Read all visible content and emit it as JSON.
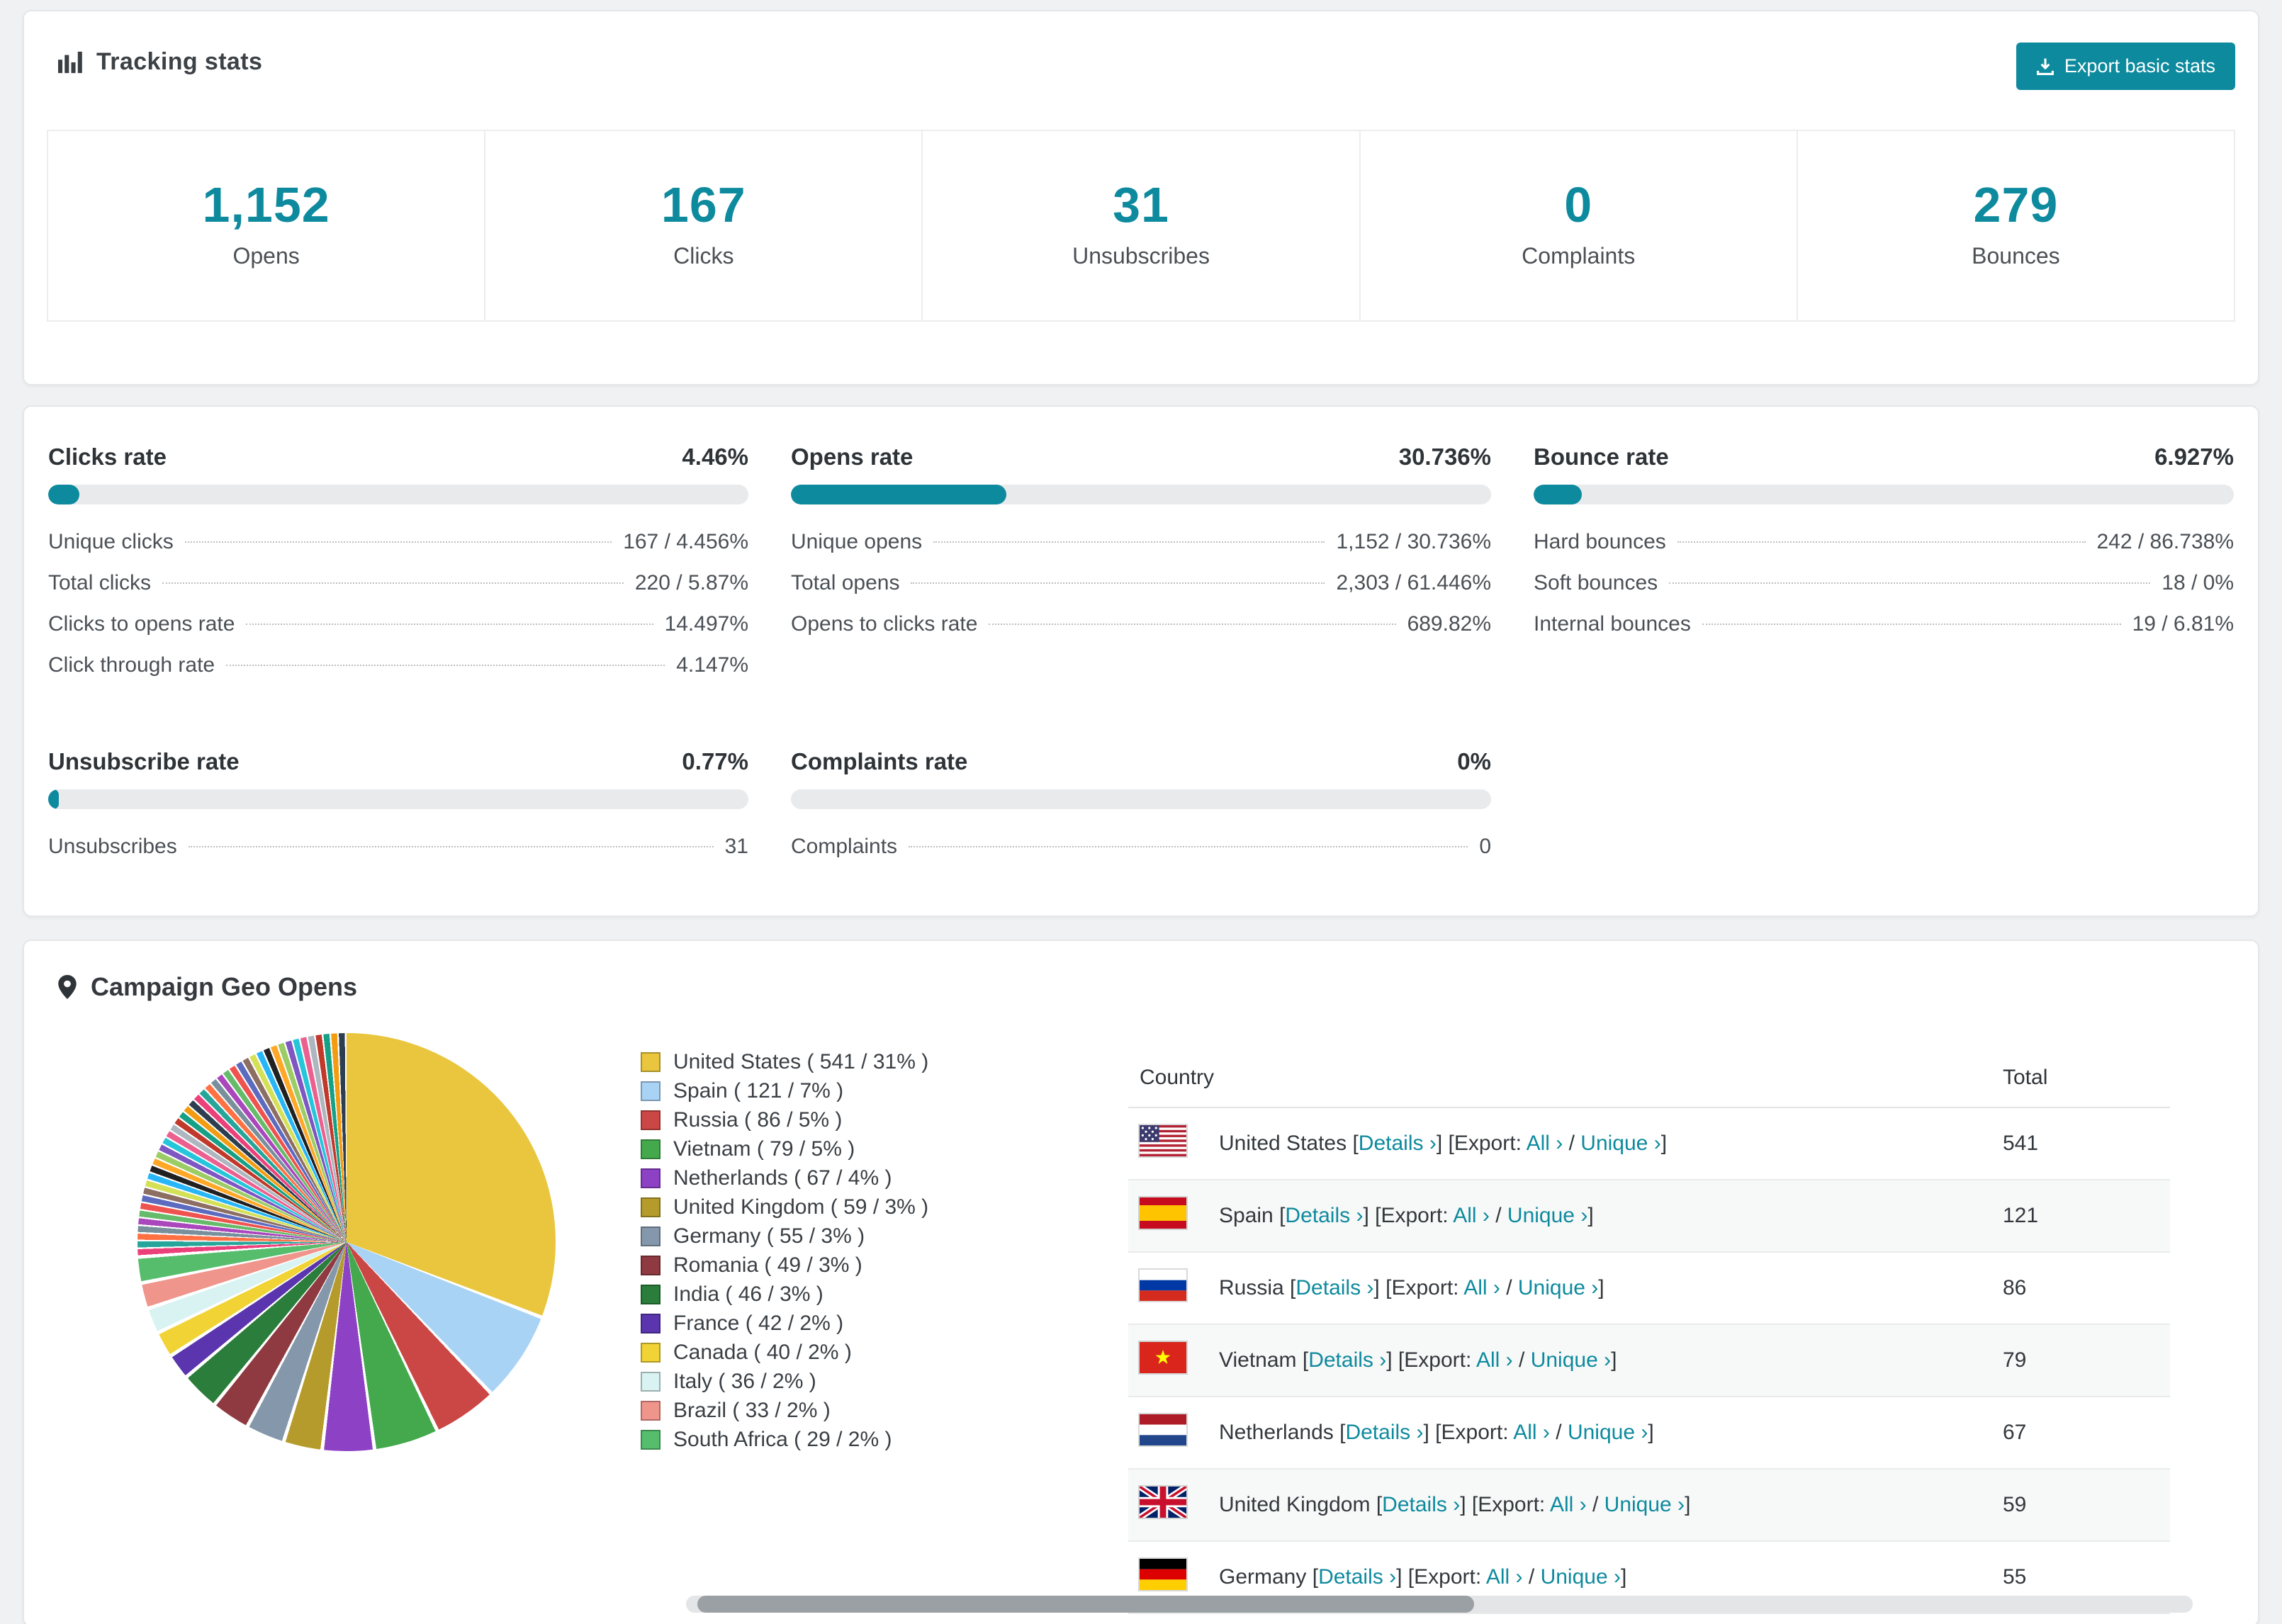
{
  "theme": {
    "accent": "#0e8a9e",
    "page_bg": "#f0f1f2",
    "panel_bg": "#ffffff"
  },
  "tracking": {
    "title": "Tracking stats",
    "export_button": "Export basic stats",
    "stats": [
      {
        "value": "1,152",
        "label": "Opens"
      },
      {
        "value": "167",
        "label": "Clicks"
      },
      {
        "value": "31",
        "label": "Unsubscribes"
      },
      {
        "value": "0",
        "label": "Complaints"
      },
      {
        "value": "279",
        "label": "Bounces"
      }
    ]
  },
  "rates": [
    {
      "title": "Clicks rate",
      "percent_label": "4.46%",
      "percent": 4.46,
      "rows": [
        {
          "label": "Unique clicks",
          "value": "167 / 4.456%"
        },
        {
          "label": "Total clicks",
          "value": "220 / 5.87%"
        },
        {
          "label": "Clicks to opens rate",
          "value": "14.497%"
        },
        {
          "label": "Click through rate",
          "value": "4.147%"
        }
      ]
    },
    {
      "title": "Opens rate",
      "percent_label": "30.736%",
      "percent": 30.736,
      "rows": [
        {
          "label": "Unique opens",
          "value": "1,152 / 30.736%"
        },
        {
          "label": "Total opens",
          "value": "2,303 / 61.446%"
        },
        {
          "label": "Opens to clicks rate",
          "value": "689.82%"
        }
      ]
    },
    {
      "title": "Bounce rate",
      "percent_label": "6.927%",
      "percent": 6.927,
      "rows": [
        {
          "label": "Hard bounces",
          "value": "242 / 86.738%"
        },
        {
          "label": "Soft bounces",
          "value": "18 / 0%"
        },
        {
          "label": "Internal bounces",
          "value": "19 / 6.81%"
        }
      ]
    },
    {
      "title": "Unsubscribe rate",
      "percent_label": "0.77%",
      "percent": 0.77,
      "rows": [
        {
          "label": "Unsubscribes",
          "value": "31"
        }
      ]
    },
    {
      "title": "Complaints rate",
      "percent_label": "0%",
      "percent": 0,
      "rows": [
        {
          "label": "Complaints",
          "value": "0"
        }
      ]
    }
  ],
  "geo": {
    "title": "Campaign Geo Opens",
    "table": {
      "columns": [
        "Country",
        "Total"
      ],
      "link_labels": {
        "details": "Details",
        "export": "Export:",
        "all": "All",
        "unique": "Unique",
        "chevron": "›",
        "open_bracket": "[",
        "close_bracket": "]",
        "slash": "/"
      },
      "rows": [
        {
          "country": "United States",
          "total": "541",
          "flag": "us"
        },
        {
          "country": "Spain",
          "total": "121",
          "flag": "es"
        },
        {
          "country": "Russia",
          "total": "86",
          "flag": "ru"
        },
        {
          "country": "Vietnam",
          "total": "79",
          "flag": "vn"
        },
        {
          "country": "Netherlands",
          "total": "67",
          "flag": "nl"
        },
        {
          "country": "United Kingdom",
          "total": "59",
          "flag": "gb"
        },
        {
          "country": "Germany",
          "total": "55",
          "flag": "de"
        }
      ]
    }
  },
  "chart_data": {
    "type": "pie",
    "title": "Campaign Geo Opens",
    "legend_position": "right",
    "start_angle_deg": 0,
    "direction": "clockwise",
    "slices": [
      {
        "label": "United States",
        "value": 541,
        "percent": 31,
        "color": "#e9c63e"
      },
      {
        "label": "Spain",
        "value": 121,
        "percent": 7,
        "color": "#a9d3f5"
      },
      {
        "label": "Russia",
        "value": 86,
        "percent": 5,
        "color": "#cb4745"
      },
      {
        "label": "Vietnam",
        "value": 79,
        "percent": 5,
        "color": "#44a94d"
      },
      {
        "label": "Netherlands",
        "value": 67,
        "percent": 4,
        "color": "#8d41c4"
      },
      {
        "label": "United Kingdom",
        "value": 59,
        "percent": 3,
        "color": "#b59b2b"
      },
      {
        "label": "Germany",
        "value": 55,
        "percent": 3,
        "color": "#8598ab"
      },
      {
        "label": "Romania",
        "value": 49,
        "percent": 3,
        "color": "#8e3a40"
      },
      {
        "label": "India",
        "value": 46,
        "percent": 3,
        "color": "#2a7d3a"
      },
      {
        "label": "France",
        "value": 42,
        "percent": 2,
        "color": "#5a35ae"
      },
      {
        "label": "Canada",
        "value": 40,
        "percent": 2,
        "color": "#f1d335"
      },
      {
        "label": "Italy",
        "value": 36,
        "percent": 2,
        "color": "#d8f3f2"
      },
      {
        "label": "Brazil",
        "value": 33,
        "percent": 2,
        "color": "#f0958c"
      },
      {
        "label": "South Africa",
        "value": 29,
        "percent": 2,
        "color": "#55bd6c"
      }
    ],
    "others": {
      "note": "many small unlabeled country slices filling the remainder",
      "percent_total": 26,
      "count": 44,
      "colors": [
        "#ec407a",
        "#26a69a",
        "#ff7043",
        "#78909c",
        "#ab47bc",
        "#66bb6a",
        "#ef5350",
        "#5c6bc0",
        "#8d6e63",
        "#d4e157",
        "#29b6f6",
        "#212121",
        "#ffa726",
        "#9ccc65",
        "#7e57c2",
        "#26c6da",
        "#ec6090",
        "#aeb6bf",
        "#c0392b",
        "#16a085",
        "#f39c12",
        "#2c3e50"
      ]
    },
    "legend_format": "{label} ( {value} / {percent}% )"
  }
}
